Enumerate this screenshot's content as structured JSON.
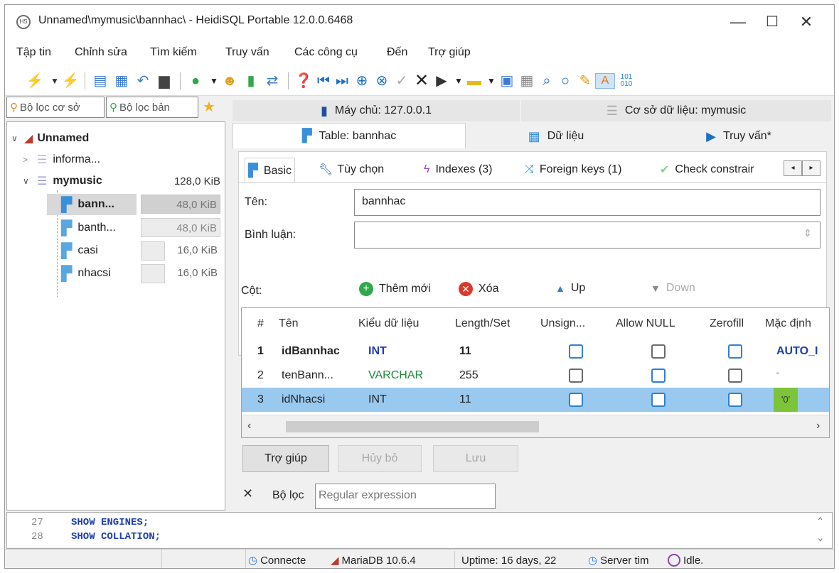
{
  "window": {
    "title": "Unnamed\\mymusic\\bannhac\\ - HeidiSQL Portable 12.0.0.6468",
    "app_icon": "heidisql-icon",
    "controls": [
      "—",
      "☐",
      "✕"
    ]
  },
  "menu": [
    "Tập tin",
    "Chỉnh sửa",
    "Tìm kiếm",
    "Truy vấn",
    "Các công cụ",
    "Đến",
    "Trợ giúp"
  ],
  "left": {
    "filter_db_placeholder": "Bộ lọc cơ sở",
    "filter_table_placeholder": "Bộ lọc bản",
    "tree": {
      "root": "Unnamed",
      "databases": [
        {
          "name": "informa...",
          "size": ""
        },
        {
          "name": "mymusic",
          "size": "128,0 KiB"
        }
      ],
      "tables": [
        {
          "name": "bann...",
          "size": "48,0 KiB"
        },
        {
          "name": "banth...",
          "size": "48,0 KiB"
        },
        {
          "name": "casi",
          "size": "16,0 KiB"
        },
        {
          "name": "nhacsi",
          "size": "16,0 KiB"
        }
      ]
    }
  },
  "tabs": {
    "host": "Máy chủ: 127.0.0.1",
    "database": "Cơ sở dữ liệu: mymusic",
    "table": "Table: bannhac",
    "data": "Dữ liệu",
    "query": "Truy vấn*"
  },
  "subtabs": [
    "Basic",
    "Tùy chọn",
    "Indexes (3)",
    "Foreign keys (1)",
    "Check constrair"
  ],
  "form": {
    "name_label": "Tên:",
    "name_value": "bannhac",
    "comment_label": "Bình luận:",
    "comment_value": ""
  },
  "columns_bar": {
    "label": "Cột:",
    "add": "Thêm mới",
    "delete": "Xóa",
    "up": "Up",
    "down": "Down"
  },
  "grid": {
    "headers": [
      "#",
      "Tên",
      "Kiểu dữ liệu",
      "Length/Set",
      "Unsign...",
      "Allow NULL",
      "Zerofill",
      "Mặc định"
    ],
    "rows": [
      {
        "num": "1",
        "name": "idBannhac",
        "type": "INT",
        "length": "11",
        "default": "AUTO_I"
      },
      {
        "num": "2",
        "name": "tenBann...",
        "type": "VARCHAR",
        "length": "255",
        "default": "''"
      },
      {
        "num": "3",
        "name": "idNhacsi",
        "type": "INT",
        "length": "11",
        "default": "'0'"
      }
    ]
  },
  "buttons": {
    "help": "Trợ giúp",
    "cancel": "Hủy bỏ",
    "save": "Lưu"
  },
  "filter": {
    "label": "Bộ lọc",
    "placeholder": "Regular expression"
  },
  "sql_log": [
    {
      "line": "27",
      "text": "SHOW ENGINES;"
    },
    {
      "line": "28",
      "text": "SHOW COLLATION;"
    }
  ],
  "status": {
    "connected": "Connecte",
    "server": "MariaDB 10.6.4",
    "uptime": "Uptime: 16 days, 22",
    "server_time": "Server tim",
    "idle": "Idle."
  },
  "colors": {
    "selection": "#99c9ef",
    "accent": "#2e7fd9",
    "green": "#2ea84a",
    "red": "#d93a2b"
  }
}
